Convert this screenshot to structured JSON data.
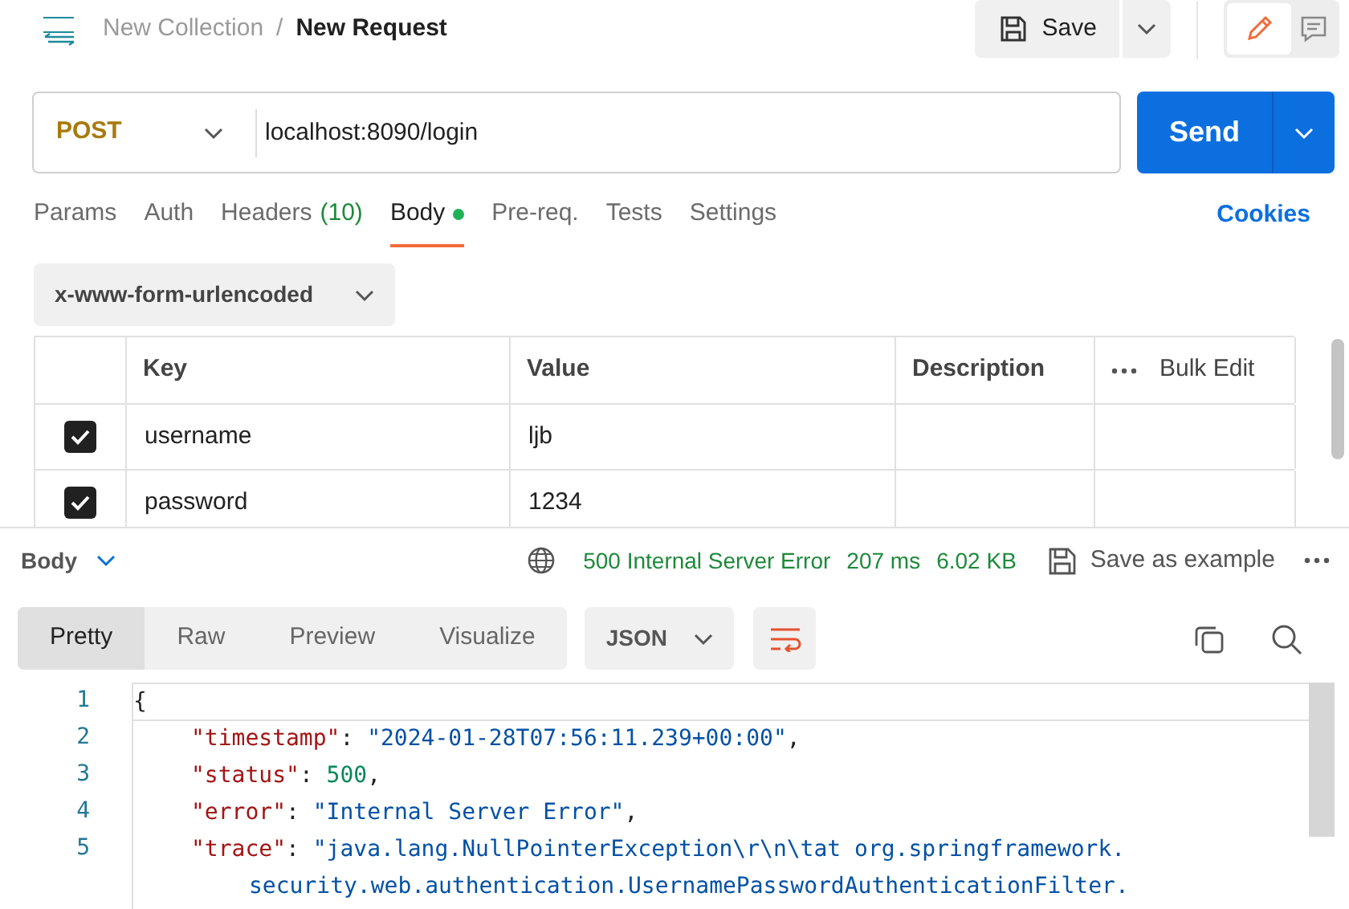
{
  "breadcrumb": {
    "collection": "New Collection",
    "separator": "/",
    "request": "New Request"
  },
  "save_button": "Save",
  "mode_buttons": [
    {
      "kind": "edit",
      "selected": true
    },
    {
      "kind": "comment",
      "selected": false
    }
  ],
  "request": {
    "method": "POST",
    "url": "localhost:8090/login",
    "send": "Send"
  },
  "tabs": [
    {
      "label": "Params",
      "selected": false
    },
    {
      "label": "Auth",
      "selected": false
    },
    {
      "label": "Headers",
      "count": "(10)",
      "selected": false
    },
    {
      "label": "Body",
      "dot": true,
      "selected": true
    },
    {
      "label": "Pre-req.",
      "selected": false
    },
    {
      "label": "Tests",
      "selected": false
    },
    {
      "label": "Settings",
      "selected": false
    }
  ],
  "cookies": "Cookies",
  "body_type": "x-www-form-urlencoded",
  "table": {
    "columns": [
      "Key",
      "Value",
      "Description"
    ],
    "bulk_edit": "Bulk Edit",
    "rows": [
      {
        "checked": true,
        "key": "username",
        "value": "ljb"
      },
      {
        "checked": true,
        "key": "password",
        "value": "1234"
      }
    ]
  },
  "response": {
    "label": "Body",
    "status": "500 Internal Server Error",
    "time": "207 ms",
    "size": "6.02 KB",
    "save_example": "Save as example"
  },
  "view_tabs": [
    {
      "label": "Pretty",
      "selected": true
    },
    {
      "label": "Raw",
      "selected": false
    },
    {
      "label": "Preview",
      "selected": false
    },
    {
      "label": "Visualize",
      "selected": false
    }
  ],
  "format": "JSON",
  "code": [
    {
      "number": "1",
      "tokens": [
        {
          "kind": "punct",
          "text": "{"
        }
      ]
    },
    {
      "number": "2",
      "tokens": [
        {
          "kind": "key",
          "text": "\"timestamp\""
        },
        {
          "kind": "punct",
          "text": ": "
        },
        {
          "kind": "string",
          "text": "\"2024-01-28T07:56:11.239+00:00\""
        },
        {
          "kind": "punct",
          "text": ","
        }
      ]
    },
    {
      "number": "3",
      "tokens": [
        {
          "kind": "key",
          "text": "\"status\""
        },
        {
          "kind": "punct",
          "text": ": "
        },
        {
          "kind": "number",
          "text": "500"
        },
        {
          "kind": "punct",
          "text": ","
        }
      ]
    },
    {
      "number": "4",
      "tokens": [
        {
          "kind": "key",
          "text": "\"error\""
        },
        {
          "kind": "punct",
          "text": ": "
        },
        {
          "kind": "string",
          "text": "\"Internal Server Error\""
        },
        {
          "kind": "punct",
          "text": ","
        }
      ]
    },
    {
      "number": "5",
      "tokens": [
        {
          "kind": "key",
          "text": "\"trace\""
        },
        {
          "kind": "punct",
          "text": ": "
        },
        {
          "kind": "string",
          "text": "\"java.lang.NullPointerException\\r\\n\\tat org.springframework."
        }
      ],
      "continuation": [
        "security.web.authentication.UsernamePasswordAuthenticationFilter."
      ]
    }
  ]
}
